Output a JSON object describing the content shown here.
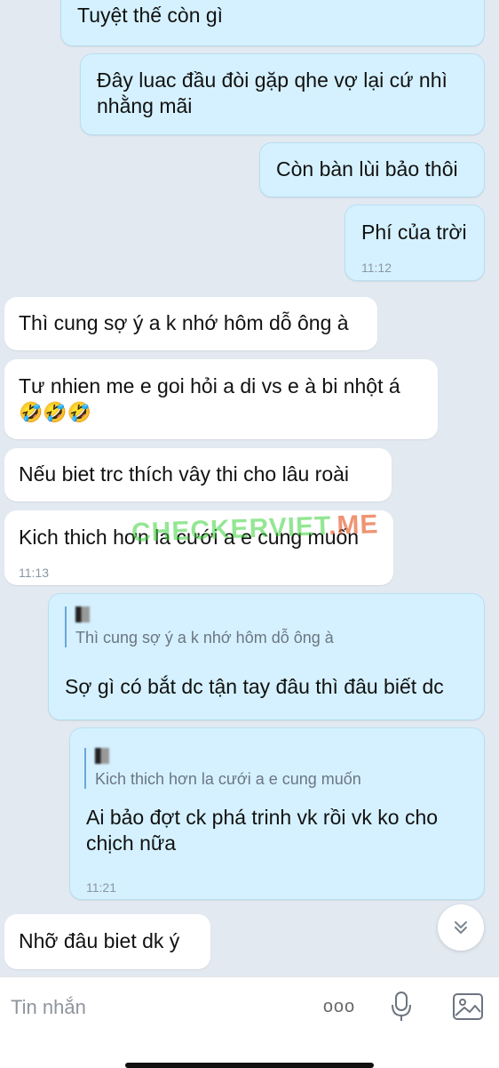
{
  "messages": [
    {
      "text": "Tuyệt thế còn gì"
    },
    {
      "text": "Đây luac đầu đòi gặp qhe vợ lại cứ nhì nhằng mãi"
    },
    {
      "text": "Còn bàn lùi bảo thôi"
    },
    {
      "text": "Phí của trời",
      "time": "11:12"
    },
    {
      "text": "Thì cung sợ ý a k nhớ hôm dỗ ông à"
    },
    {
      "text": "Tư nhien me e goi hỏi a di vs e à bi nhột á",
      "emoji": "🤣🤣🤣"
    },
    {
      "text": "Nếu biet trc thích vây thi cho lâu roài"
    },
    {
      "text": "Kich thich hơn la cưới a e cung muốn",
      "time": "11:13"
    },
    {
      "quote": "Thì cung sợ ý a k nhớ hôm dỗ ông à",
      "text": "Sợ gì có bắt dc tận tay đâu thì đâu biết dc"
    },
    {
      "quote": "Kich thich hơn la cưới a e cung muốn",
      "text": "Ai bảo đợt ck phá trinh vk rồi vk ko cho chịch nữa",
      "time": "11:21"
    },
    {
      "text": "Nhỡ đâu biet dk ý"
    }
  ],
  "watermark": {
    "main": "CHECKERVIET",
    "suffix": ".ME"
  },
  "composer": {
    "placeholder": "Tin nhắn",
    "more_label": "ooo"
  },
  "colors": {
    "sent_bubble": "#d5f1ff",
    "received_bubble": "#ffffff",
    "background": "#e2e9f1"
  },
  "icons": [
    "chevron-double-down-icon",
    "more-icon",
    "microphone-icon",
    "image-icon"
  ]
}
